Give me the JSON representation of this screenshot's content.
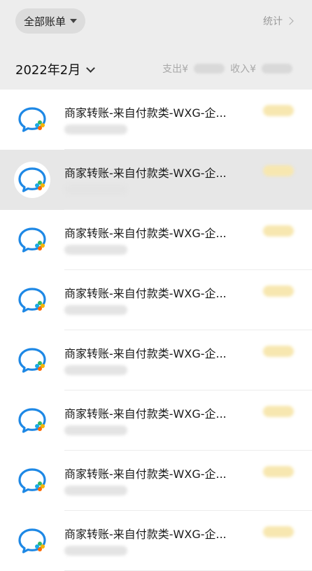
{
  "header": {
    "filter_label": "全部账单",
    "stats_label": "统计"
  },
  "month_bar": {
    "month_label": "2022年2月",
    "expense_label": "支出¥",
    "income_label": "收入¥"
  },
  "transactions": [
    {
      "title": "商家转账-来自付款类-WXG-企...",
      "icon": "wechat-work-icon",
      "active": false
    },
    {
      "title": "商家转账-来自付款类-WXG-企...",
      "icon": "wechat-work-icon",
      "active": true
    },
    {
      "title": "商家转账-来自付款类-WXG-企...",
      "icon": "wechat-work-icon",
      "active": false
    },
    {
      "title": "商家转账-来自付款类-WXG-企...",
      "icon": "wechat-work-icon",
      "active": false
    },
    {
      "title": "商家转账-来自付款类-WXG-企...",
      "icon": "wechat-work-icon",
      "active": false
    },
    {
      "title": "商家转账-来自付款类-WXG-企...",
      "icon": "wechat-work-icon",
      "active": false
    },
    {
      "title": "商家转账-来自付款类-WXG-企...",
      "icon": "wechat-work-icon",
      "active": false
    },
    {
      "title": "商家转账-来自付款类-WXG-企...",
      "icon": "wechat-work-icon",
      "active": false
    }
  ],
  "colors": {
    "bubble_blue": "#1e88e5",
    "accent_green": "#2fb86a",
    "accent_yellow": "#f5b400",
    "accent_orange": "#ff6a00",
    "accent_cyan": "#19a9e6"
  }
}
